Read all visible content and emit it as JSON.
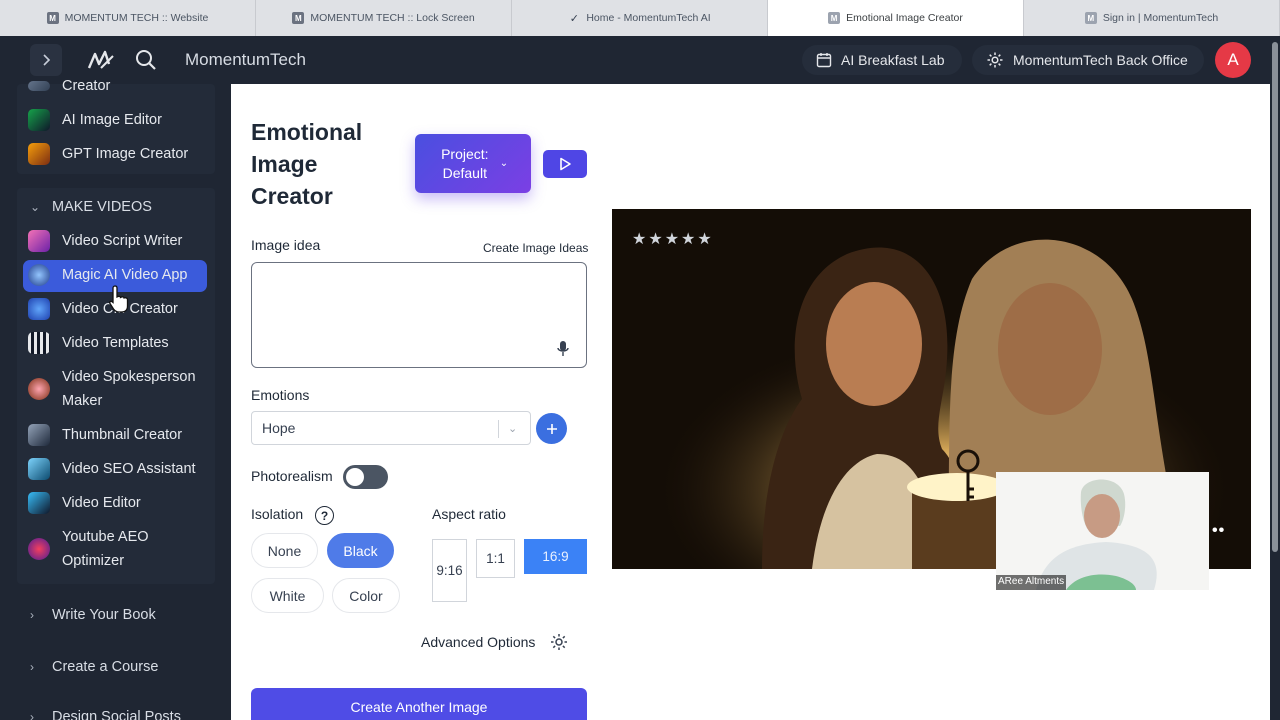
{
  "browser": {
    "tabs": [
      {
        "title": "MOMENTUM TECH :: Website",
        "active": false
      },
      {
        "title": "MOMENTUM TECH :: Lock Screen",
        "active": false
      },
      {
        "title": "Home - MomentumTech AI",
        "active": false
      },
      {
        "title": "Emotional Image Creator",
        "active": true
      },
      {
        "title": "Sign in | MomentumTech",
        "active": false
      }
    ]
  },
  "header": {
    "brand": "MomentumTech",
    "lab_label": "AI Breakfast Lab",
    "office_label": "MomentumTech Back Office",
    "avatar_initial": "A"
  },
  "sidebar": {
    "top_items": [
      {
        "label": "Creator"
      },
      {
        "label": "AI Image Editor"
      },
      {
        "label": "GPT Image Creator"
      }
    ],
    "section_make_videos": "MAKE VIDEOS",
    "video_items": [
      {
        "label": "Video Script Writer"
      },
      {
        "label": "Magic AI Video App"
      },
      {
        "label": "Video C... Creator"
      },
      {
        "label": "Video Templates"
      },
      {
        "label": "Video Spokesperson Maker"
      },
      {
        "label": "Thumbnail Creator"
      },
      {
        "label": "Video SEO Assistant"
      },
      {
        "label": "Video Editor"
      },
      {
        "label": "Youtube AEO Optimizer"
      }
    ],
    "sections": [
      {
        "label": "Write Your Book"
      },
      {
        "label": "Create a Course"
      },
      {
        "label": "Design Social Posts"
      }
    ]
  },
  "main": {
    "title": "Emotional Image Creator",
    "project_label": "Project: Default",
    "image_idea_label": "Image idea",
    "create_ideas_link": "Create Image Ideas",
    "image_idea_value": "",
    "emotions_label": "Emotions",
    "emotion_selected": "Hope",
    "photorealism_label": "Photorealism",
    "photorealism_on": false,
    "isolation_label": "Isolation",
    "isolation_options": [
      "None",
      "Black",
      "White",
      "Color"
    ],
    "isolation_selected": "Black",
    "aspect_label": "Aspect ratio",
    "aspect_options": [
      "9:16",
      "1:1",
      "16:9"
    ],
    "aspect_selected": "16:9",
    "advanced_label": "Advanced Options",
    "create_button": "Create Another Image"
  },
  "preview": {
    "rating_stars": 5,
    "webcam_name": "ARee Altments"
  },
  "colors": {
    "sidebar_bg": "#1f2633",
    "active_item": "#3b5bdb",
    "primary": "#4f4ce6",
    "avatar": "#e53946"
  }
}
